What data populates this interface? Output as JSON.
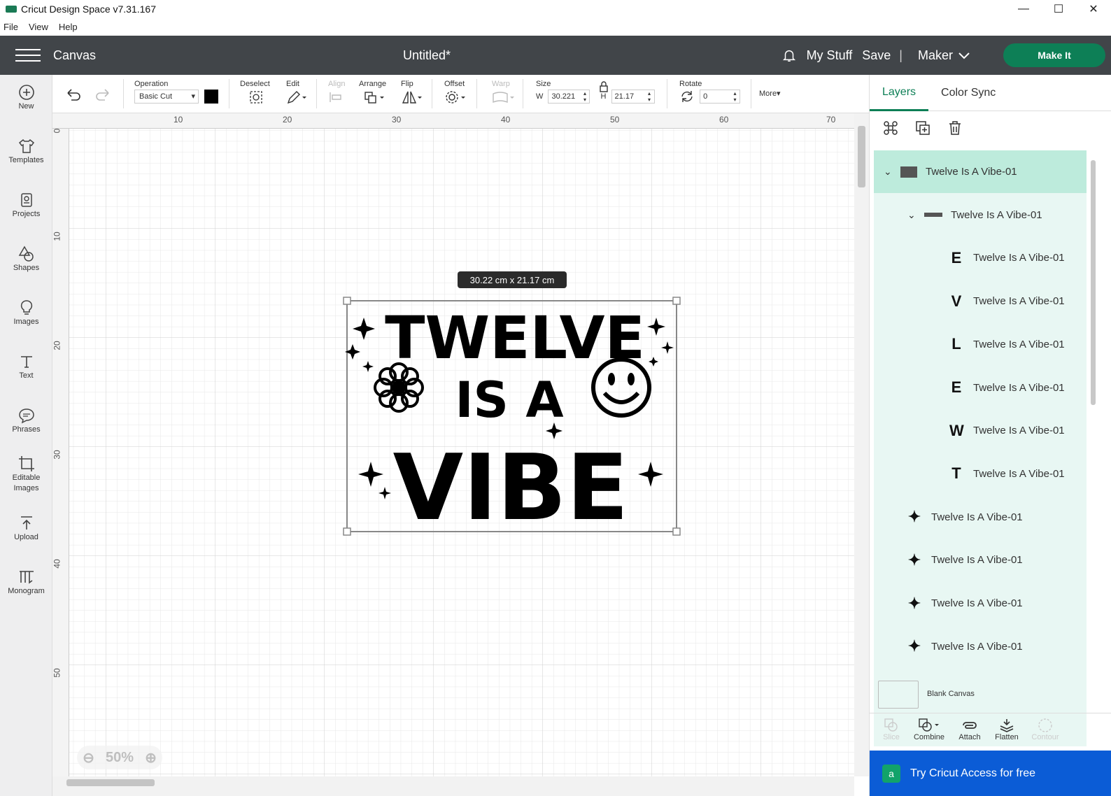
{
  "window": {
    "title": "Cricut Design Space  v7.31.167",
    "controls": [
      "—",
      "☐",
      "✕"
    ]
  },
  "menu": [
    "File",
    "View",
    "Help"
  ],
  "header": {
    "section": "Canvas",
    "doc_title": "Untitled*",
    "my_stuff": "My Stuff",
    "save": "Save",
    "separator": "|",
    "machine": "Maker",
    "make_it": "Make It"
  },
  "left_tools": [
    {
      "label": "New",
      "icon": "plus-circle-icon"
    },
    {
      "label": "Templates",
      "icon": "shirt-icon"
    },
    {
      "label": "Projects",
      "icon": "projects-icon"
    },
    {
      "label": "Shapes",
      "icon": "shapes-icon"
    },
    {
      "label": "Images",
      "icon": "lightbulb-icon"
    },
    {
      "label": "Text",
      "icon": "text-icon"
    },
    {
      "label": "Phrases",
      "icon": "speech-bubble-icon"
    },
    {
      "label": "Editable Images",
      "icon": "crop-icon"
    },
    {
      "label": "Upload",
      "icon": "upload-icon"
    },
    {
      "label": "Monogram",
      "icon": "monogram-icon"
    }
  ],
  "toolbar": {
    "operation_label": "Operation",
    "operation_value": "Basic Cut",
    "operation_color": "#000000",
    "deselect": "Deselect",
    "edit": "Edit",
    "align": "Align",
    "arrange": "Arrange",
    "flip": "Flip",
    "offset": "Offset",
    "warp": "Warp",
    "size": "Size",
    "w_label": "W",
    "w_value": "30.221",
    "h_label": "H",
    "h_value": "21.17",
    "rotate": "Rotate",
    "rotate_value": "0",
    "more": "More▾"
  },
  "canvas": {
    "ruler_top": [
      "10",
      "20",
      "30",
      "40",
      "50",
      "60",
      "70"
    ],
    "ruler_left": [
      "0",
      "10",
      "20",
      "30",
      "40",
      "50"
    ],
    "selection_size": "30.22  cm x 21.17  cm",
    "design_lines": [
      "TWELVE",
      "IS A",
      "VIBE"
    ],
    "zoom": "50%"
  },
  "panel": {
    "tabs": [
      "Layers",
      "Color Sync"
    ],
    "layers": [
      {
        "name": "Twelve Is A Vibe-01",
        "level": 0,
        "glyph": "",
        "expand": true,
        "selected": true
      },
      {
        "name": "Twelve Is A Vibe-01",
        "level": 1,
        "glyph": "",
        "expand": true
      },
      {
        "name": "Twelve Is A Vibe-01",
        "level": 2,
        "glyph": "E"
      },
      {
        "name": "Twelve Is A Vibe-01",
        "level": 2,
        "glyph": "V"
      },
      {
        "name": "Twelve Is A Vibe-01",
        "level": 2,
        "glyph": "L"
      },
      {
        "name": "Twelve Is A Vibe-01",
        "level": 2,
        "glyph": "E"
      },
      {
        "name": "Twelve Is A Vibe-01",
        "level": 2,
        "glyph": "W"
      },
      {
        "name": "Twelve Is A Vibe-01",
        "level": 2,
        "glyph": "T"
      },
      {
        "name": "Twelve Is A Vibe-01",
        "level": 1,
        "glyph": "✦"
      },
      {
        "name": "Twelve Is A Vibe-01",
        "level": 1,
        "glyph": "✦"
      },
      {
        "name": "Twelve Is A Vibe-01",
        "level": 1,
        "glyph": "✦"
      },
      {
        "name": "Twelve Is A Vibe-01",
        "level": 1,
        "glyph": "✦"
      }
    ],
    "blank_canvas": "Blank Canvas",
    "actions": [
      "Slice",
      "Combine",
      "Attach",
      "Flatten",
      "Contour"
    ],
    "access_banner": "Try Cricut Access for free"
  }
}
